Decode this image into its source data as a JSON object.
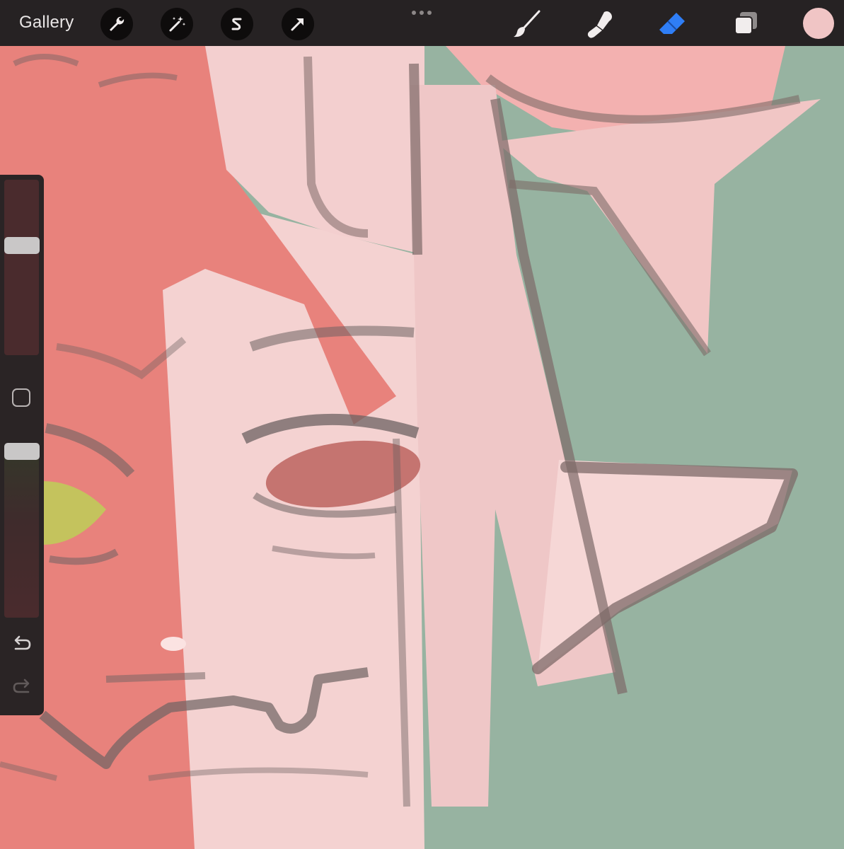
{
  "toolbar": {
    "gallery_label": "Gallery",
    "left_tools": [
      "wrench-icon",
      "magic-wand-icon",
      "selection-s-icon",
      "transform-arrow-icon"
    ],
    "more_icon": "ellipsis-icon",
    "right_tools": [
      "brush-icon",
      "smudge-icon",
      "eraser-icon",
      "layers-icon"
    ],
    "active_tool": "eraser",
    "accent_color": "#2f7ef6",
    "current_color": "#f0c5c5"
  },
  "sidebar": {
    "brush_size_icon": "brush-size-slider",
    "modify_icon": "square-modify-icon",
    "opacity_icon": "opacity-slider",
    "undo_icon": "undo-icon",
    "redo_icon": "redo-icon",
    "redo_enabled": false
  },
  "canvas": {
    "background_color": "#97b3a1"
  }
}
